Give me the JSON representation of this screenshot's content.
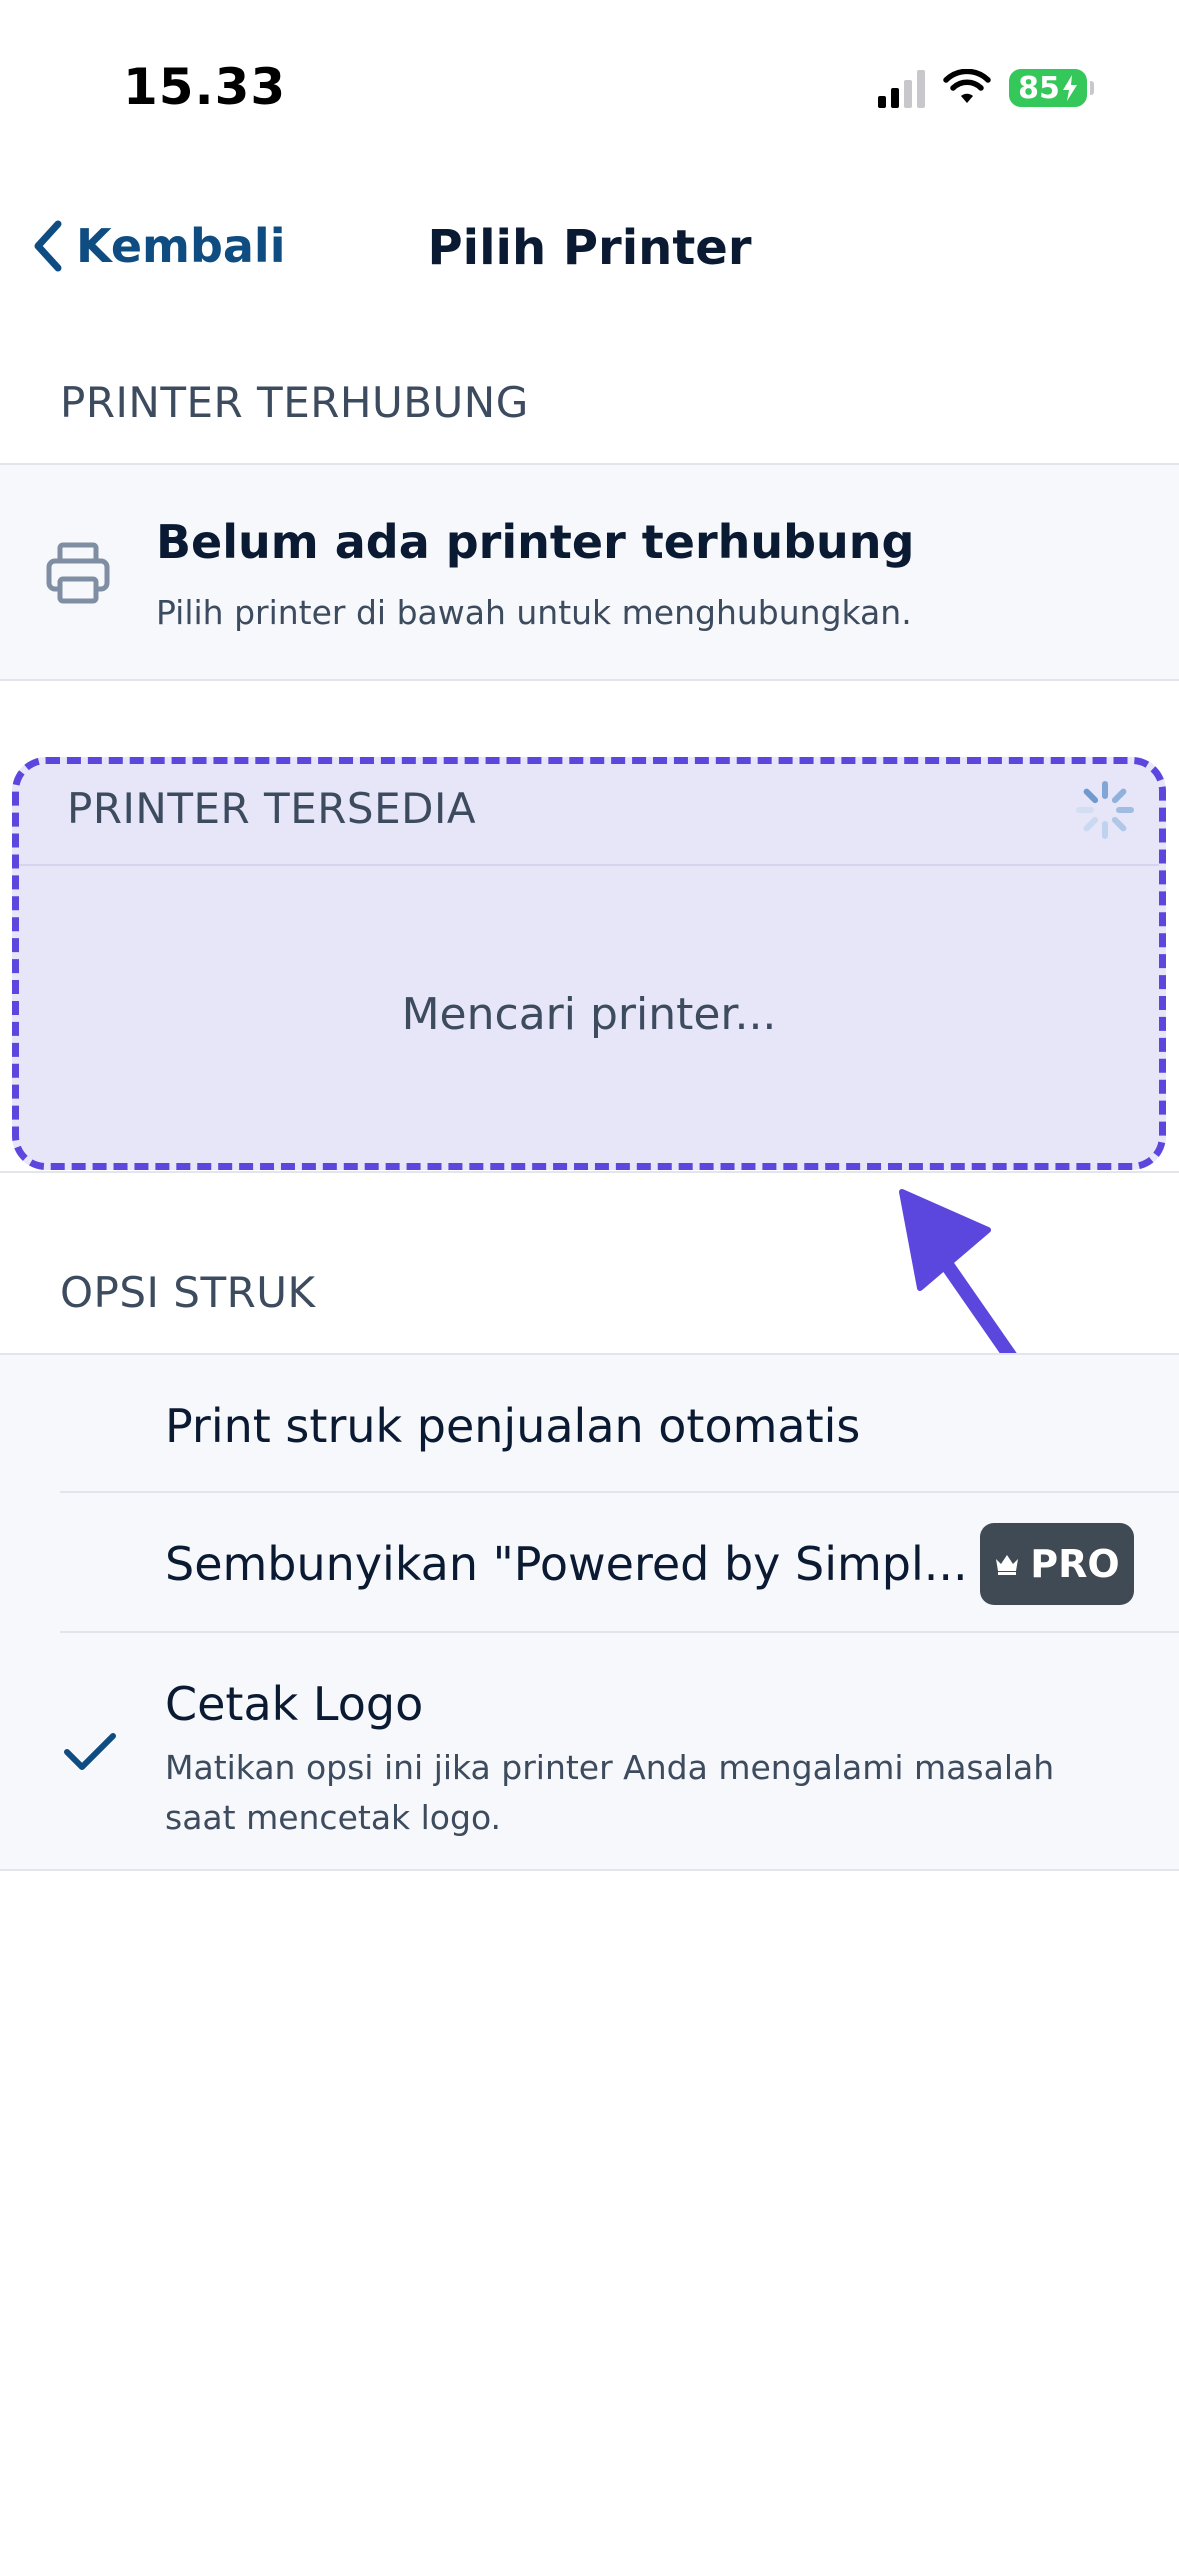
{
  "status_bar": {
    "time": "15.33",
    "battery": "85"
  },
  "nav": {
    "back_label": "Kembali",
    "title": "Pilih Printer"
  },
  "connected": {
    "section_label": "PRINTER TERHUBUNG",
    "title": "Belum ada printer terhubung",
    "subtitle": "Pilih printer di bawah untuk menghubungkan."
  },
  "available": {
    "section_label": "PRINTER TERSEDIA",
    "status_text": "Mencari printer..."
  },
  "options": {
    "section_label": "OPSI STRUK",
    "items": [
      {
        "label": "Print struk penjualan otomatis"
      },
      {
        "label": "Sembunyikan \"Powered by Simpl...",
        "badge": "PRO"
      },
      {
        "label": "Cetak Logo",
        "description": "Matikan opsi ini jika printer Anda mengalami masalah saat mencetak logo."
      }
    ]
  },
  "colors": {
    "accent": "#0f4c81",
    "highlight": "#5b47dd",
    "battery": "#34c759"
  }
}
